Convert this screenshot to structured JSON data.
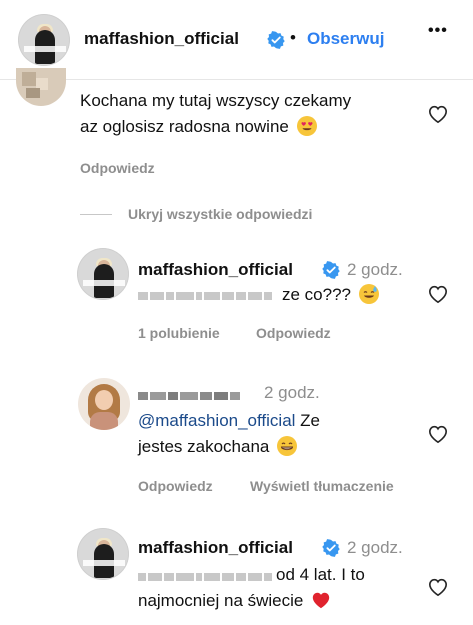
{
  "header": {
    "username": "maffashion_official",
    "separator": "•",
    "follow_label": "Obserwuj",
    "more_label": "•••"
  },
  "comment1": {
    "text_line1": "Kochana my tutaj wszyscy czekamy",
    "text_line2": "az oglosisz radosna nowine",
    "emoji": "heart-eyes-emoji",
    "reply_label": "Odpowiedz"
  },
  "hide_replies_label": "Ukryj wszystkie odpowiedzi",
  "reply1": {
    "username": "maffashion_official",
    "time": "2 godz.",
    "text": "ze co???",
    "emoji": "sweat-smile-emoji",
    "likes_label": "1 polubienie",
    "reply_label": "Odpowiedz"
  },
  "reply2": {
    "time": "2 godz.",
    "mention": "@maffashion_official",
    "text_line1_rest": " Ze",
    "text_line2": "jestes zakochana",
    "emoji": "grin-emoji",
    "reply_label": "Odpowiedz",
    "translate_label": "Wyświetl tłumaczenie"
  },
  "reply3": {
    "username": "maffashion_official",
    "time": "2 godz.",
    "text_line1": "od 4 lat. I to",
    "text_line2": "najmocniej na świecie",
    "emoji": "red-heart-emoji"
  },
  "colors": {
    "link_blue": "#2d7ff0",
    "muted_gray": "#8e8e8e",
    "verified_blue": "#3897f0"
  }
}
